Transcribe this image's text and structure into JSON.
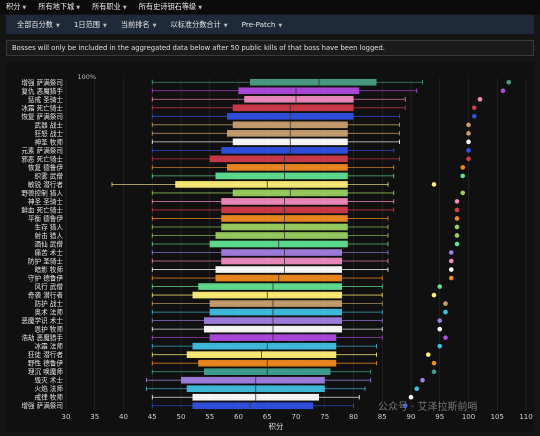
{
  "menu": {
    "items": [
      {
        "label": "积分",
        "icon": "caret-down-icon"
      },
      {
        "label": "所有地下城",
        "icon": "caret-down-icon"
      },
      {
        "label": "所有职业",
        "icon": "caret-down-icon"
      },
      {
        "label": "所有史诗钥石等级",
        "icon": "caret-down-icon"
      }
    ]
  },
  "filters": [
    {
      "label": "全部百分数",
      "icon": "caret-down-icon"
    },
    {
      "label": "1日范围",
      "icon": "caret-down-icon"
    },
    {
      "label": "当前排名",
      "icon": "caret-down-icon"
    },
    {
      "label": "以标准分数合计",
      "icon": "caret-down-icon"
    },
    {
      "label": "Pre-Patch",
      "icon": "caret-down-icon"
    }
  ],
  "notice": "Bosses will only be included in the aggregated data below after 50 public kills of that boss have been logged.",
  "watermark": "公众号 · 艾泽拉斯前哨",
  "chart_data": {
    "type": "boxplot",
    "orientation": "horizontal",
    "xlabel": "积分",
    "xlim": [
      30,
      110
    ],
    "xticks": [
      30,
      35,
      40,
      45,
      50,
      55,
      60,
      65,
      70,
      75,
      80,
      85,
      90,
      95,
      100,
      105,
      110
    ],
    "top_tick_label": "100%",
    "grid": true,
    "series": [
      {
        "name": "增强 萨满祭司",
        "min": 45,
        "q1": 62,
        "median": 74,
        "q3": 84,
        "max": 92,
        "dot": 107,
        "color": "#4a9e84"
      },
      {
        "name": "复仇 恶魔猎手",
        "min": 45,
        "q1": 60,
        "median": 70,
        "q3": 81,
        "max": 91,
        "dot": 106,
        "color": "#b04ae0"
      },
      {
        "name": "惩戒 圣骑士",
        "min": 45,
        "q1": 61,
        "median": 70,
        "q3": 80,
        "max": 89,
        "dot": 102,
        "color": "#f08cc0"
      },
      {
        "name": "冰霜 死亡骑士",
        "min": 45,
        "q1": 59,
        "median": 69,
        "q3": 80,
        "max": 89,
        "dot": 101,
        "color": "#d03a4a"
      },
      {
        "name": "恢复 萨满祭司",
        "min": 45,
        "q1": 58,
        "median": 69,
        "q3": 80,
        "max": 88,
        "dot": 101,
        "color": "#3050e0"
      },
      {
        "name": "武器 战士",
        "min": 45,
        "q1": 59,
        "median": 69,
        "q3": 79,
        "max": 88,
        "dot": 100,
        "color": "#c8a070"
      },
      {
        "name": "狂怒 战士",
        "min": 45,
        "q1": 58,
        "median": 69,
        "q3": 79,
        "max": 88,
        "dot": 100,
        "color": "#c8a070"
      },
      {
        "name": "神圣 牧师",
        "min": 45,
        "q1": 59,
        "median": 69,
        "q3": 79,
        "max": 88,
        "dot": 100,
        "color": "#ffffff"
      },
      {
        "name": "元素 萨满祭司",
        "min": 45,
        "q1": 57,
        "median": 69,
        "q3": 79,
        "max": 87,
        "dot": 100,
        "color": "#3050e0"
      },
      {
        "name": "邪恶 死亡骑士",
        "min": 45,
        "q1": 55,
        "median": 68,
        "q3": 79,
        "max": 88,
        "dot": 100,
        "color": "#d03a4a"
      },
      {
        "name": "恢复 德鲁伊",
        "min": 45,
        "q1": 58,
        "median": 68,
        "q3": 79,
        "max": 87,
        "dot": 99,
        "color": "#f08a20"
      },
      {
        "name": "织雾 武僧",
        "min": 45,
        "q1": 56,
        "median": 68,
        "q3": 79,
        "max": 87,
        "dot": 99,
        "color": "#60e090"
      },
      {
        "name": "敏锐 潜行者",
        "min": 38,
        "q1": 49,
        "median": 65,
        "q3": 79,
        "max": 86,
        "dot": 94,
        "color": "#fff078"
      },
      {
        "name": "野兽控制 猎人",
        "min": 45,
        "q1": 59,
        "median": 69,
        "q3": 79,
        "max": 87,
        "dot": 99,
        "color": "#9ad060"
      },
      {
        "name": "神圣 圣骑士",
        "min": 45,
        "q1": 57,
        "median": 68,
        "q3": 79,
        "max": 87,
        "dot": 98,
        "color": "#f08cc0"
      },
      {
        "name": "鲜血 死亡骑士",
        "min": 45,
        "q1": 57,
        "median": 68,
        "q3": 79,
        "max": 87,
        "dot": 98,
        "color": "#d03a4a"
      },
      {
        "name": "平衡 德鲁伊",
        "min": 45,
        "q1": 57,
        "median": 68,
        "q3": 79,
        "max": 86,
        "dot": 98,
        "color": "#f08a20"
      },
      {
        "name": "生存 猎人",
        "min": 45,
        "q1": 57,
        "median": 68,
        "q3": 79,
        "max": 86,
        "dot": 98,
        "color": "#9ad060"
      },
      {
        "name": "射击 猎人",
        "min": 45,
        "q1": 56,
        "median": 68,
        "q3": 79,
        "max": 86,
        "dot": 98,
        "color": "#9ad060"
      },
      {
        "name": "酒仙 武僧",
        "min": 45,
        "q1": 55,
        "median": 67,
        "q3": 79,
        "max": 86,
        "dot": 98,
        "color": "#60e090"
      },
      {
        "name": "痛苦 术士",
        "min": 45,
        "q1": 57,
        "median": 68,
        "q3": 78,
        "max": 86,
        "dot": 97,
        "color": "#a080e0"
      },
      {
        "name": "防护 圣骑士",
        "min": 45,
        "q1": 57,
        "median": 68,
        "q3": 78,
        "max": 86,
        "dot": 97,
        "color": "#f08cc0"
      },
      {
        "name": "暗影 牧师",
        "min": 45,
        "q1": 56,
        "median": 68,
        "q3": 78,
        "max": 86,
        "dot": 97,
        "color": "#ffffff"
      },
      {
        "name": "守护 德鲁伊",
        "min": 45,
        "q1": 56,
        "median": 67,
        "q3": 78,
        "max": 85,
        "dot": 97,
        "color": "#f08a20"
      },
      {
        "name": "风行 武僧",
        "min": 45,
        "q1": 53,
        "median": 66,
        "q3": 78,
        "max": 85,
        "dot": 95,
        "color": "#60e090"
      },
      {
        "name": "奇袭 潜行者",
        "min": 45,
        "q1": 52,
        "median": 65,
        "q3": 78,
        "max": 85,
        "dot": 94,
        "color": "#fff078"
      },
      {
        "name": "防护 战士",
        "min": 45,
        "q1": 55,
        "median": 66,
        "q3": 78,
        "max": 85,
        "dot": 96,
        "color": "#c8a070"
      },
      {
        "name": "奥术 法师",
        "min": 45,
        "q1": 55,
        "median": 66,
        "q3": 78,
        "max": 85,
        "dot": 96,
        "color": "#40c0e0"
      },
      {
        "name": "恶魔学识 术士",
        "min": 45,
        "q1": 54,
        "median": 66,
        "q3": 78,
        "max": 85,
        "dot": 95,
        "color": "#a080e0"
      },
      {
        "name": "恩护 牧师",
        "min": 45,
        "q1": 54,
        "median": 66,
        "q3": 78,
        "max": 85,
        "dot": 95,
        "color": "#ffffff"
      },
      {
        "name": "浩劫 恶魔猎手",
        "min": 45,
        "q1": 55,
        "median": 66,
        "q3": 77,
        "max": 85,
        "dot": 96,
        "color": "#b04ae0"
      },
      {
        "name": "冰霜 法师",
        "min": 45,
        "q1": 52,
        "median": 65,
        "q3": 77,
        "max": 84,
        "dot": 95,
        "color": "#40c0e0"
      },
      {
        "name": "狂徒 潜行者",
        "min": 45,
        "q1": 51,
        "median": 64,
        "q3": 77,
        "max": 84,
        "dot": 93,
        "color": "#fff078"
      },
      {
        "name": "野性 德鲁伊",
        "min": 45,
        "q1": 53,
        "median": 65,
        "q3": 77,
        "max": 84,
        "dot": 94,
        "color": "#f08a20"
      },
      {
        "name": "理沉 唤魔师",
        "min": 45,
        "q1": 54,
        "median": 65,
        "q3": 76,
        "max": 83,
        "dot": 94,
        "color": "#40a090"
      },
      {
        "name": "毁灭 术士",
        "min": 44,
        "q1": 50,
        "median": 63,
        "q3": 75,
        "max": 83,
        "dot": 92,
        "color": "#a080e0"
      },
      {
        "name": "火焰 法师",
        "min": 44,
        "q1": 51,
        "median": 63,
        "q3": 75,
        "max": 82,
        "dot": 91,
        "color": "#40c0e0"
      },
      {
        "name": "戒律 牧师",
        "min": 45,
        "q1": 52,
        "median": 63,
        "q3": 74,
        "max": 81,
        "dot": 90,
        "color": "#ffffff"
      },
      {
        "name": "增强 萨满祭司",
        "min": 45,
        "q1": 52,
        "median": 62,
        "q3": 73,
        "max": 80,
        "dot": 89,
        "color": "#3050e0"
      }
    ]
  }
}
